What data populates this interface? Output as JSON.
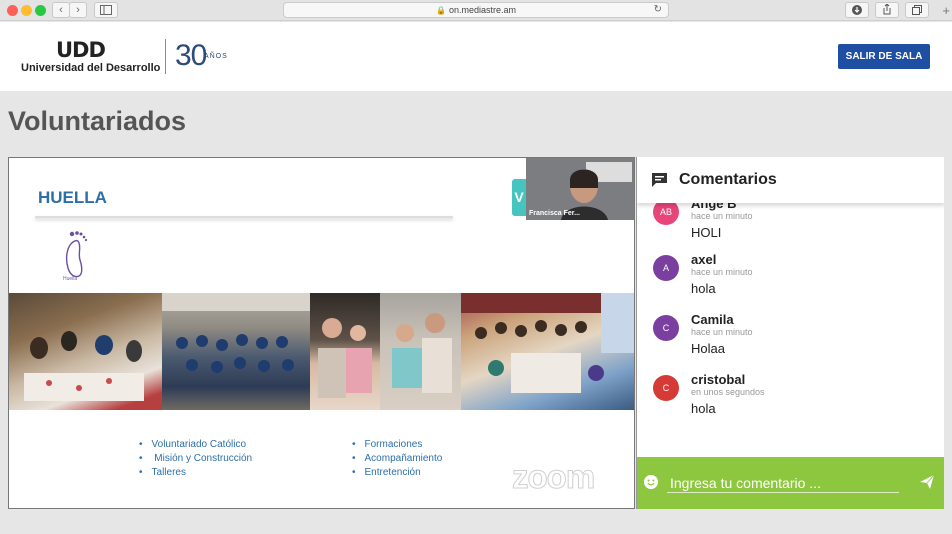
{
  "browser": {
    "url": "on.mediastre.am",
    "lock_glyph": "🔒",
    "reload_glyph": "↻",
    "back_glyph": "‹",
    "forward_glyph": "›",
    "new_tab_glyph": "+"
  },
  "header": {
    "logo_mark": "UDD",
    "logo_name": "Universidad del Desarrollo",
    "anniversary_number": "30",
    "anniversary_word": "AÑOS",
    "exit_button": "SALIR DE SALA"
  },
  "page": {
    "title": "Voluntariados"
  },
  "slide": {
    "title": "HUELLA",
    "logo_caption": "Huella",
    "tab_letter": "V",
    "bullets_left": [
      "Voluntariado Católico",
      " Misión y Construcción",
      "Talleres"
    ],
    "bullets_right": [
      "Formaciones",
      "Acompañamiento",
      "Entretención"
    ],
    "watermark": "zoom",
    "camera_name": "Francisca Fer..."
  },
  "comments": {
    "title": "Comentarios",
    "items": [
      {
        "initials": "AB",
        "name": "Ange B",
        "time": "hace un minuto",
        "text": "HOLI",
        "color": "#e8457a"
      },
      {
        "initials": "A",
        "name": "axel",
        "time": "hace un minuto",
        "text": "hola",
        "color": "#7b3fa0"
      },
      {
        "initials": "C",
        "name": "Camila",
        "time": "hace un minuto",
        "text": "Holaa",
        "color": "#7b3fa0"
      },
      {
        "initials": "C",
        "name": "cristobal",
        "time": "en unos segundos",
        "text": "hola",
        "color": "#d63a36"
      }
    ],
    "input_placeholder": "Ingresa tu comentario ...",
    "accent": "#8dc63f"
  }
}
